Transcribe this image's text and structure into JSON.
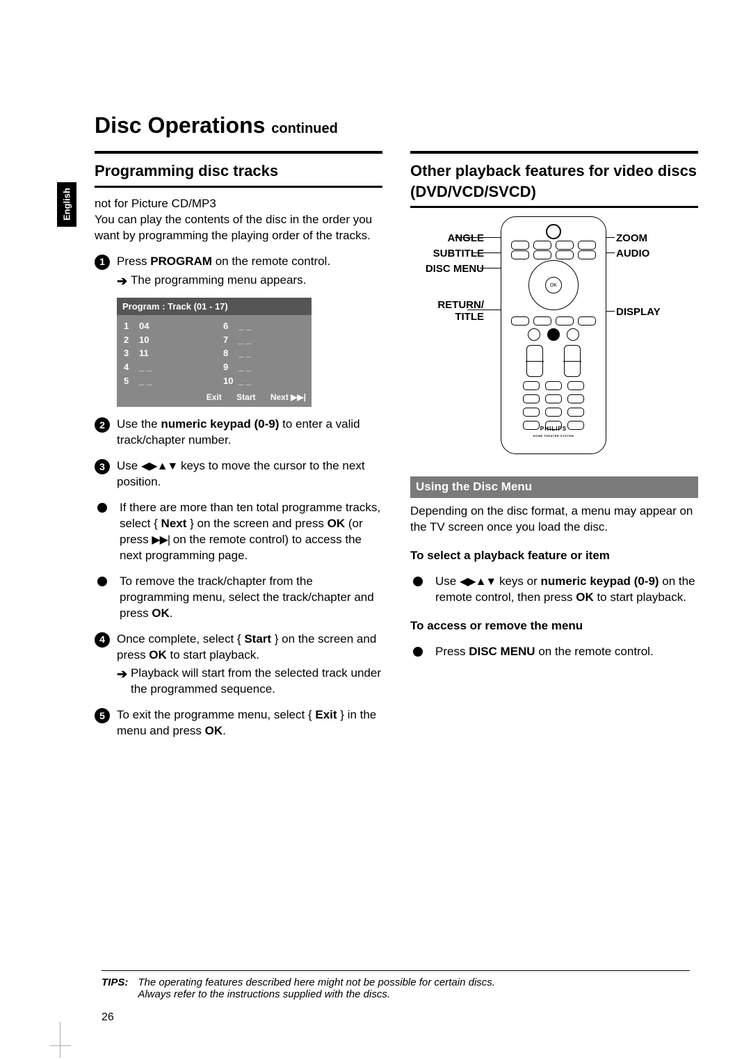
{
  "language_tab": "English",
  "page_title": "Disc Operations",
  "page_title_cont": "continued",
  "left": {
    "heading": "Programming disc tracks",
    "note": "not for Picture CD/MP3",
    "intro": "You can play the contents of the disc in the order you want by programming the playing order of the tracks.",
    "step1_a": "Press ",
    "step1_bold": "PROGRAM",
    "step1_b": " on the remote control.",
    "step1_result": "The programming menu appears.",
    "program_table": {
      "title": "Program : Track (01 - 17)",
      "colA": [
        {
          "idx": "1",
          "val": "04"
        },
        {
          "idx": "2",
          "val": "10"
        },
        {
          "idx": "3",
          "val": "11"
        },
        {
          "idx": "4",
          "val": "_ _"
        },
        {
          "idx": "5",
          "val": "_ _"
        }
      ],
      "colB": [
        {
          "idx": "6",
          "val": "_ _"
        },
        {
          "idx": "7",
          "val": "_ _"
        },
        {
          "idx": "8",
          "val": "_ _"
        },
        {
          "idx": "9",
          "val": "_ _"
        },
        {
          "idx": "10",
          "val": "_ _"
        }
      ],
      "foot": {
        "exit": "Exit",
        "start": "Start",
        "next": "Next ▶▶|"
      }
    },
    "step2_a": "Use the ",
    "step2_bold": "numeric keypad (0-9)",
    "step2_b": " to enter a valid track/chapter number.",
    "step3_a": "Use ",
    "step3_keys": "◀▶▲▼",
    "step3_b": " keys to move the cursor to the next position.",
    "bullet_a1": "If there are more than ten total programme tracks, select { ",
    "bullet_a1_bold": "Next",
    "bullet_a2": " } on the screen and press ",
    "bullet_a2_bold": "OK",
    "bullet_a3": " (or press ",
    "bullet_a3_sym": "▶▶|",
    "bullet_a4": " on the remote control) to access the next programming page.",
    "bullet_b1": "To remove the track/chapter from the programming menu, select the track/chapter and press ",
    "bullet_b1_bold": "OK",
    "bullet_b2": ".",
    "step4_a": "Once complete, select { ",
    "step4_bold1": "Start",
    "step4_b": " } on the screen and press ",
    "step4_bold2": "OK",
    "step4_c": " to start playback.",
    "step4_result": "Playback will start from the selected track under the programmed sequence.",
    "step5_a": "To exit the programme menu, select { ",
    "step5_bold": "Exit",
    "step5_b": " } in the menu and press ",
    "step5_bold2": "OK",
    "step5_c": "."
  },
  "right": {
    "heading": "Other playback features for video discs (DVD/VCD/SVCD)",
    "remote_labels": {
      "angle": "ANGLE",
      "subtitle": "SUBTITLE",
      "disc_menu": "DISC MENU",
      "return_title": "RETURN/\nTITLE",
      "zoom": "ZOOM",
      "audio": "AUDIO",
      "display": "DISPLAY"
    },
    "remote_brand": "PHILIPS",
    "remote_brand_sub": "HOME THEATER SYSTEM",
    "sub_heading": "Using the Disc Menu",
    "p1": "Depending on the disc format, a menu may appear on the TV screen once you load the disc.",
    "h_select": "To select a playback feature or item",
    "select_a": "Use ",
    "select_keys": "◀▶▲▼",
    "select_b": " keys or ",
    "select_bold": "numeric keypad (0-9)",
    "select_c": " on the remote control, then press ",
    "select_bold2": "OK",
    "select_d": " to start playback.",
    "h_access": "To access or remove the menu",
    "access_a": "Press ",
    "access_bold": "DISC MENU",
    "access_b": " on the remote control."
  },
  "tips": {
    "label": "TIPS:",
    "line1": "The operating features described here might not be possible for certain discs.",
    "line2": "Always refer to the instructions supplied with the discs."
  },
  "page_number": "26"
}
